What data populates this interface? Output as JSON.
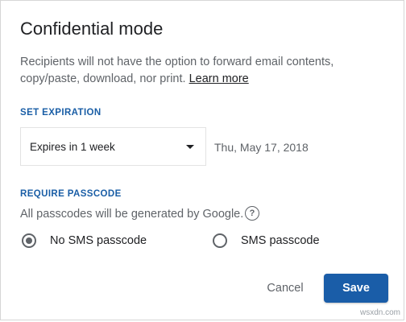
{
  "dialog": {
    "title": "Confidential mode",
    "description": "Recipients will not have the option to forward email contents, copy/paste, download, nor print.",
    "learn_more": "Learn more"
  },
  "expiration": {
    "label": "SET EXPIRATION",
    "selected": "Expires in 1 week",
    "date": "Thu, May 17, 2018"
  },
  "passcode": {
    "label": "REQUIRE PASSCODE",
    "description": "All passcodes will be generated by Google.",
    "help_icon_glyph": "?",
    "options": [
      {
        "label": "No SMS passcode",
        "checked": true
      },
      {
        "label": "SMS passcode",
        "checked": false
      }
    ]
  },
  "actions": {
    "cancel": "Cancel",
    "save": "Save"
  },
  "watermark": "wsxdn.com",
  "colors": {
    "accent": "#1a5da8",
    "section_label": "#1a5ea6",
    "text_primary": "#202124",
    "text_secondary": "#5f6368"
  }
}
